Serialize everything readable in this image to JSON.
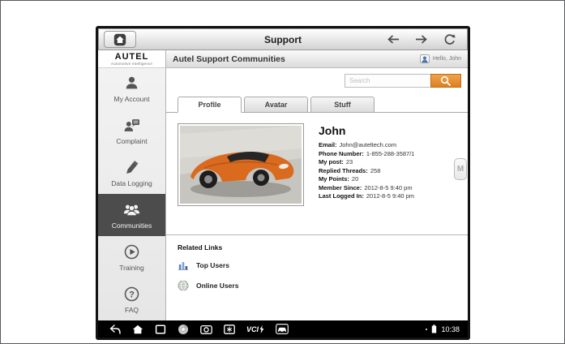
{
  "titlebar": {
    "title": "Support"
  },
  "sidebar": {
    "logo": {
      "brand": "AUTEL",
      "tagline": "Automotive Intelligence"
    },
    "items": [
      {
        "label": "My Account",
        "selected": false
      },
      {
        "label": "Complaint",
        "selected": false
      },
      {
        "label": "Data Logging",
        "selected": false
      },
      {
        "label": "Communities",
        "selected": true
      },
      {
        "label": "Training",
        "selected": false
      },
      {
        "label": "FAQ",
        "selected": false
      }
    ]
  },
  "main": {
    "header": {
      "title": "Autel Support Communities",
      "greeting": "Hello, John"
    },
    "search": {
      "placeholder": "Search"
    },
    "tabs": [
      {
        "label": "Profile",
        "active": true
      },
      {
        "label": "Avatar",
        "active": false
      },
      {
        "label": "Stuff",
        "active": false
      }
    ],
    "profile": {
      "name": "John",
      "fields": [
        {
          "label": "Email:",
          "value": "John@auteltech.com"
        },
        {
          "label": "Phone Number:",
          "value": "1-855-288-3587/1"
        },
        {
          "label": "My post:",
          "value": "23"
        },
        {
          "label": "Replied Threads:",
          "value": "258"
        },
        {
          "label": "My Points:",
          "value": "20"
        },
        {
          "label": "Member Since:",
          "value": "2012-8-5 9:40 pm"
        },
        {
          "label": "Last Logged In:",
          "value": "2012-8-5 9:40 pm"
        }
      ]
    },
    "side_tab_label": "M",
    "related_links": {
      "title": "Related Links",
      "links": [
        {
          "label": "Top Users"
        },
        {
          "label": "Online Users"
        }
      ]
    }
  },
  "bottombar": {
    "vci_label": "VCI",
    "time": "10:38"
  },
  "colors": {
    "search_button_orange": "#dd7f22",
    "selected_item_gray": "#4c4c4c",
    "car_orange": "#d96a1e"
  }
}
